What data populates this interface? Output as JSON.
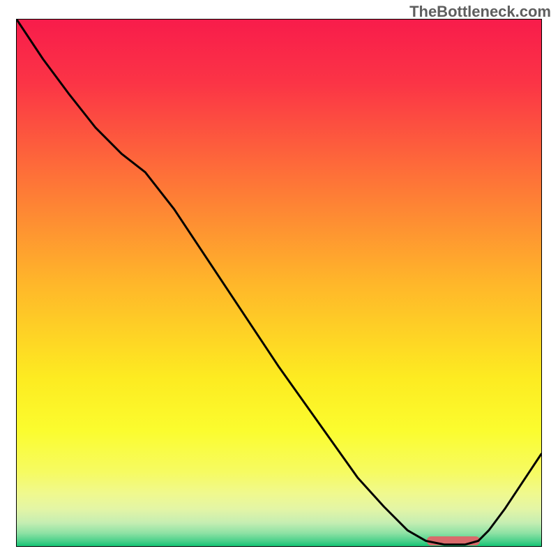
{
  "watermark": "TheBottleneck.com",
  "chart_data": {
    "type": "line",
    "title": "",
    "xlabel": "",
    "ylabel": "",
    "x": [
      0.0,
      0.05,
      0.1,
      0.15,
      0.2,
      0.245,
      0.3,
      0.35,
      0.4,
      0.45,
      0.5,
      0.55,
      0.6,
      0.65,
      0.7,
      0.745,
      0.78,
      0.815,
      0.855,
      0.88,
      0.9,
      0.93,
      0.96,
      1.0
    ],
    "y": [
      1.0,
      0.925,
      0.858,
      0.795,
      0.745,
      0.71,
      0.64,
      0.565,
      0.49,
      0.415,
      0.34,
      0.27,
      0.2,
      0.13,
      0.075,
      0.03,
      0.01,
      0.003,
      0.003,
      0.01,
      0.03,
      0.07,
      0.115,
      0.175
    ],
    "xlim": [
      0,
      1
    ],
    "ylim": [
      0,
      1
    ],
    "grid": false,
    "gradient_stops": [
      {
        "offset": 0.0,
        "color": "#f81c4b"
      },
      {
        "offset": 0.12,
        "color": "#fb3446"
      },
      {
        "offset": 0.3,
        "color": "#fe7238"
      },
      {
        "offset": 0.5,
        "color": "#ffb62a"
      },
      {
        "offset": 0.68,
        "color": "#fdeb21"
      },
      {
        "offset": 0.78,
        "color": "#fbfc2e"
      },
      {
        "offset": 0.86,
        "color": "#f6fb62"
      },
      {
        "offset": 0.9,
        "color": "#f0f98e"
      },
      {
        "offset": 0.93,
        "color": "#e3f5a6"
      },
      {
        "offset": 0.955,
        "color": "#c6eeb2"
      },
      {
        "offset": 0.975,
        "color": "#8fe2a5"
      },
      {
        "offset": 0.99,
        "color": "#4dd18b"
      },
      {
        "offset": 1.0,
        "color": "#14c574"
      }
    ],
    "marker": {
      "x0": 0.78,
      "x1": 0.88,
      "y": 0.009,
      "color": "#d86b6b"
    }
  }
}
